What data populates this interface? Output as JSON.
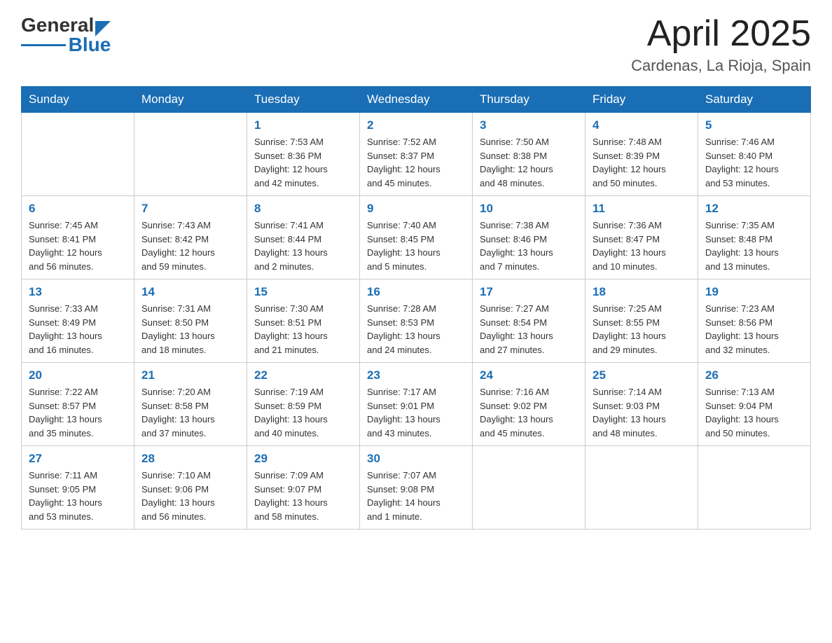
{
  "header": {
    "logo": {
      "general": "General",
      "blue": "Blue"
    },
    "title": "April 2025",
    "location": "Cardenas, La Rioja, Spain"
  },
  "weekdays": [
    "Sunday",
    "Monday",
    "Tuesday",
    "Wednesday",
    "Thursday",
    "Friday",
    "Saturday"
  ],
  "weeks": [
    [
      {
        "day": "",
        "info": ""
      },
      {
        "day": "",
        "info": ""
      },
      {
        "day": "1",
        "info": "Sunrise: 7:53 AM\nSunset: 8:36 PM\nDaylight: 12 hours\nand 42 minutes."
      },
      {
        "day": "2",
        "info": "Sunrise: 7:52 AM\nSunset: 8:37 PM\nDaylight: 12 hours\nand 45 minutes."
      },
      {
        "day": "3",
        "info": "Sunrise: 7:50 AM\nSunset: 8:38 PM\nDaylight: 12 hours\nand 48 minutes."
      },
      {
        "day": "4",
        "info": "Sunrise: 7:48 AM\nSunset: 8:39 PM\nDaylight: 12 hours\nand 50 minutes."
      },
      {
        "day": "5",
        "info": "Sunrise: 7:46 AM\nSunset: 8:40 PM\nDaylight: 12 hours\nand 53 minutes."
      }
    ],
    [
      {
        "day": "6",
        "info": "Sunrise: 7:45 AM\nSunset: 8:41 PM\nDaylight: 12 hours\nand 56 minutes."
      },
      {
        "day": "7",
        "info": "Sunrise: 7:43 AM\nSunset: 8:42 PM\nDaylight: 12 hours\nand 59 minutes."
      },
      {
        "day": "8",
        "info": "Sunrise: 7:41 AM\nSunset: 8:44 PM\nDaylight: 13 hours\nand 2 minutes."
      },
      {
        "day": "9",
        "info": "Sunrise: 7:40 AM\nSunset: 8:45 PM\nDaylight: 13 hours\nand 5 minutes."
      },
      {
        "day": "10",
        "info": "Sunrise: 7:38 AM\nSunset: 8:46 PM\nDaylight: 13 hours\nand 7 minutes."
      },
      {
        "day": "11",
        "info": "Sunrise: 7:36 AM\nSunset: 8:47 PM\nDaylight: 13 hours\nand 10 minutes."
      },
      {
        "day": "12",
        "info": "Sunrise: 7:35 AM\nSunset: 8:48 PM\nDaylight: 13 hours\nand 13 minutes."
      }
    ],
    [
      {
        "day": "13",
        "info": "Sunrise: 7:33 AM\nSunset: 8:49 PM\nDaylight: 13 hours\nand 16 minutes."
      },
      {
        "day": "14",
        "info": "Sunrise: 7:31 AM\nSunset: 8:50 PM\nDaylight: 13 hours\nand 18 minutes."
      },
      {
        "day": "15",
        "info": "Sunrise: 7:30 AM\nSunset: 8:51 PM\nDaylight: 13 hours\nand 21 minutes."
      },
      {
        "day": "16",
        "info": "Sunrise: 7:28 AM\nSunset: 8:53 PM\nDaylight: 13 hours\nand 24 minutes."
      },
      {
        "day": "17",
        "info": "Sunrise: 7:27 AM\nSunset: 8:54 PM\nDaylight: 13 hours\nand 27 minutes."
      },
      {
        "day": "18",
        "info": "Sunrise: 7:25 AM\nSunset: 8:55 PM\nDaylight: 13 hours\nand 29 minutes."
      },
      {
        "day": "19",
        "info": "Sunrise: 7:23 AM\nSunset: 8:56 PM\nDaylight: 13 hours\nand 32 minutes."
      }
    ],
    [
      {
        "day": "20",
        "info": "Sunrise: 7:22 AM\nSunset: 8:57 PM\nDaylight: 13 hours\nand 35 minutes."
      },
      {
        "day": "21",
        "info": "Sunrise: 7:20 AM\nSunset: 8:58 PM\nDaylight: 13 hours\nand 37 minutes."
      },
      {
        "day": "22",
        "info": "Sunrise: 7:19 AM\nSunset: 8:59 PM\nDaylight: 13 hours\nand 40 minutes."
      },
      {
        "day": "23",
        "info": "Sunrise: 7:17 AM\nSunset: 9:01 PM\nDaylight: 13 hours\nand 43 minutes."
      },
      {
        "day": "24",
        "info": "Sunrise: 7:16 AM\nSunset: 9:02 PM\nDaylight: 13 hours\nand 45 minutes."
      },
      {
        "day": "25",
        "info": "Sunrise: 7:14 AM\nSunset: 9:03 PM\nDaylight: 13 hours\nand 48 minutes."
      },
      {
        "day": "26",
        "info": "Sunrise: 7:13 AM\nSunset: 9:04 PM\nDaylight: 13 hours\nand 50 minutes."
      }
    ],
    [
      {
        "day": "27",
        "info": "Sunrise: 7:11 AM\nSunset: 9:05 PM\nDaylight: 13 hours\nand 53 minutes."
      },
      {
        "day": "28",
        "info": "Sunrise: 7:10 AM\nSunset: 9:06 PM\nDaylight: 13 hours\nand 56 minutes."
      },
      {
        "day": "29",
        "info": "Sunrise: 7:09 AM\nSunset: 9:07 PM\nDaylight: 13 hours\nand 58 minutes."
      },
      {
        "day": "30",
        "info": "Sunrise: 7:07 AM\nSunset: 9:08 PM\nDaylight: 14 hours\nand 1 minute."
      },
      {
        "day": "",
        "info": ""
      },
      {
        "day": "",
        "info": ""
      },
      {
        "day": "",
        "info": ""
      }
    ]
  ]
}
